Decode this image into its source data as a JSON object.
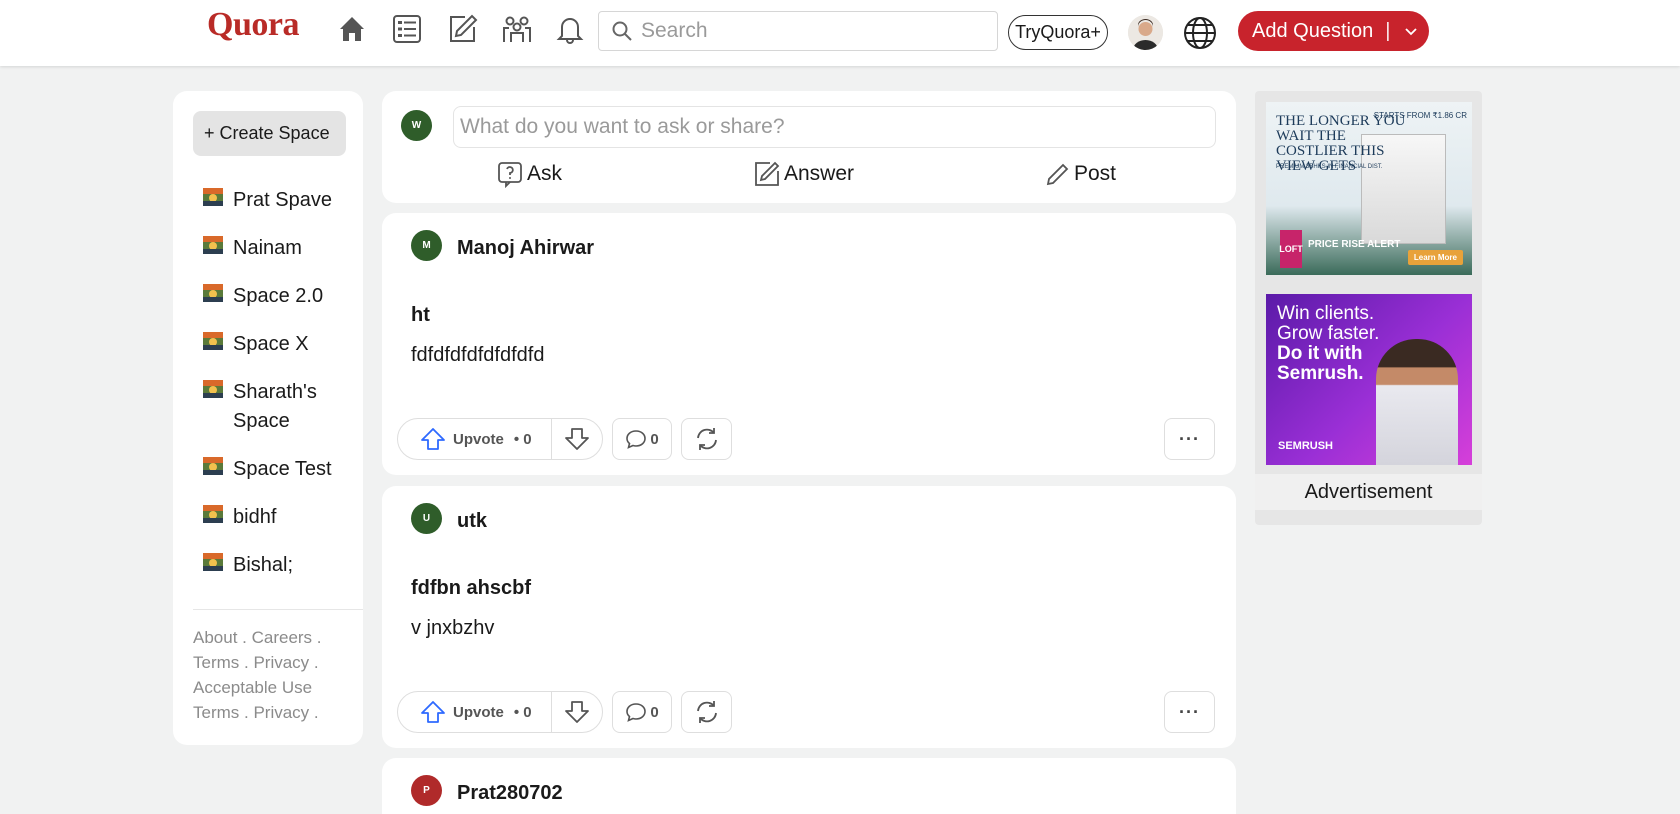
{
  "header": {
    "logo": "Quora",
    "search_placeholder": "Search",
    "try_label": "TryQuora+",
    "add_question_label": "Add Question",
    "add_question_separator": "|"
  },
  "nav_icons": [
    "home-icon",
    "following-icon",
    "answer-icon",
    "spaces-icon",
    "notifications-icon"
  ],
  "colors": {
    "brand": "#b92b27",
    "add_question_bg": "#c8232c",
    "page_bg": "#f1f2f2",
    "avatar_green": "#2f5d2a",
    "avatar_red": "#b02a2a"
  },
  "sidebar": {
    "create_space_label": "+ Create Space",
    "spaces": [
      {
        "label": "Prat Spave"
      },
      {
        "label": "Nainam"
      },
      {
        "label": "Space 2.0"
      },
      {
        "label": "Space X"
      },
      {
        "label": "Sharath's Space"
      },
      {
        "label": "Space Test"
      },
      {
        "label": "bidhf"
      },
      {
        "label": "Bishal;"
      }
    ],
    "footer_lines": [
      "About . Careers .",
      "Terms . Privacy .",
      "Acceptable Use",
      "Terms . Privacy ."
    ]
  },
  "ask_box": {
    "avatar_letter": "W",
    "placeholder": "What do you want to ask or share?",
    "actions": {
      "ask": "Ask",
      "answer": "Answer",
      "post": "Post"
    }
  },
  "posts": [
    {
      "avatar_letter": "M",
      "author": "Manoj Ahirwar",
      "title": "ht",
      "body": "fdfdfdfdfdfdfdfd",
      "upvote_label": "Upvote",
      "upvote_count": "• 0",
      "comment_count": "0",
      "more_label": "···"
    },
    {
      "avatar_letter": "U",
      "author": "utk",
      "title": "fdfbn ahscbf",
      "body": "v jnxbzhv",
      "upvote_label": "Upvote",
      "upvote_count": "• 0",
      "comment_count": "0",
      "more_label": "···"
    },
    {
      "avatar_letter": "P",
      "author": "Prat280702"
    }
  ],
  "ads": {
    "ad1": {
      "headline": "THE LONGER YOU WAIT THE COSTLIER THIS VIEW GETS",
      "price": "STARTS FROM ₹1.86 CR",
      "sub": "PREMIUM 3BHKS IN FINANCIAL DIST.",
      "brand": "LOFT",
      "alert": "PRICE RISE ALERT",
      "cta": "Learn More"
    },
    "ad2": {
      "line1": "Win clients.",
      "line2": "Grow faster.",
      "line3": "Do it with",
      "line4": "Semrush.",
      "brand": "SEMRUSH"
    },
    "caption": "Advertisement"
  }
}
